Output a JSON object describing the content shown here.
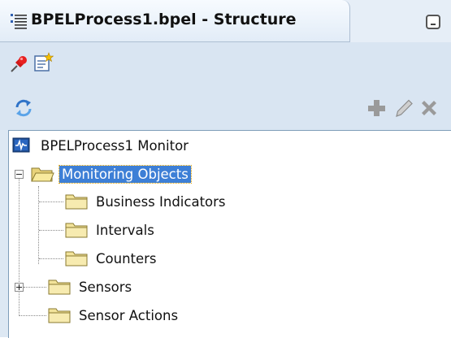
{
  "panel": {
    "title": "BPELProcess1.bpel - Structure",
    "icons": {
      "tab": "structure-icon",
      "minimize": "minimize-icon",
      "pin": "pin-icon",
      "new_view": "new-view-icon",
      "refresh": "refresh-icon",
      "add": "add-icon",
      "edit": "edit-icon",
      "delete": "delete-icon"
    }
  },
  "tree": {
    "root": {
      "label": "BPELProcess1 Monitor",
      "icon": "monitor-icon"
    },
    "monitoring_objects": {
      "label": "Monitoring Objects",
      "expanded": true,
      "selected": true
    },
    "business_indicators": {
      "label": "Business Indicators"
    },
    "intervals": {
      "label": "Intervals"
    },
    "counters": {
      "label": "Counters"
    },
    "sensors": {
      "label": "Sensors",
      "expanded": false
    },
    "sensor_actions": {
      "label": "Sensor Actions"
    }
  },
  "colors": {
    "selection": "#3d7fd6",
    "folder": "#f2e39a",
    "toolbar_bg": "#d9e5f2"
  }
}
